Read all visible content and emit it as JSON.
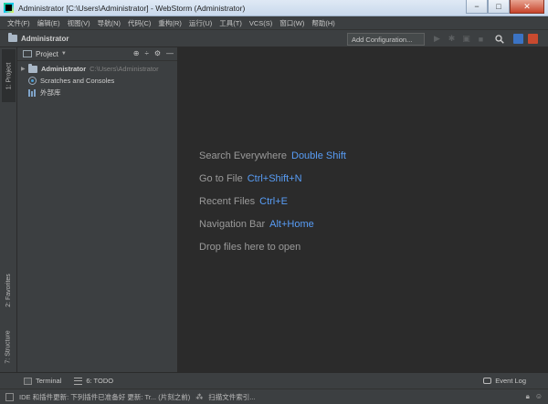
{
  "window": {
    "title": "Administrator [C:\\Users\\Administrator] - WebStorm (Administrator)",
    "controls": {
      "minimize": "−",
      "maximize": "□",
      "close": "✕"
    }
  },
  "menu": [
    "文件(F)",
    "编辑(E)",
    "视图(V)",
    "导航(N)",
    "代码(C)",
    "重构(R)",
    "运行(U)",
    "工具(T)",
    "VCS(S)",
    "窗口(W)",
    "帮助(H)"
  ],
  "navbar": {
    "crumb": "Administrator",
    "add_configuration": "Add Configuration...",
    "icons": [
      "run-icon",
      "debug-icon",
      "coverage-icon",
      "stop-icon",
      "build-icon",
      "search-icon",
      "webstorm-icon",
      "toolbox-icon"
    ]
  },
  "left_strip": {
    "tabs": [
      "1: Project",
      "2: Favorites",
      "7: Structure"
    ]
  },
  "project_panel": {
    "title": "Project",
    "tree": {
      "root_label": "Administrator",
      "root_path": "C:\\Users\\Administrator",
      "scratches": "Scratches and Consoles",
      "libraries": "外部库"
    }
  },
  "editor": {
    "hints": [
      {
        "text": "Search Everywhere",
        "key": "Double Shift"
      },
      {
        "text": "Go to File",
        "key": "Ctrl+Shift+N"
      },
      {
        "text": "Recent Files",
        "key": "Ctrl+E"
      },
      {
        "text": "Navigation Bar",
        "key": "Alt+Home"
      },
      {
        "text": "Drop files here to open",
        "key": ""
      }
    ]
  },
  "bottombar": {
    "terminal": "Terminal",
    "todo": "6: TODO",
    "event_log": "Event Log"
  },
  "statusbar": {
    "message": "IDE 和插件更新: 下列插件已准备好 更新: Tr... (片刻之前)",
    "progress": "扫描文件索引..."
  }
}
